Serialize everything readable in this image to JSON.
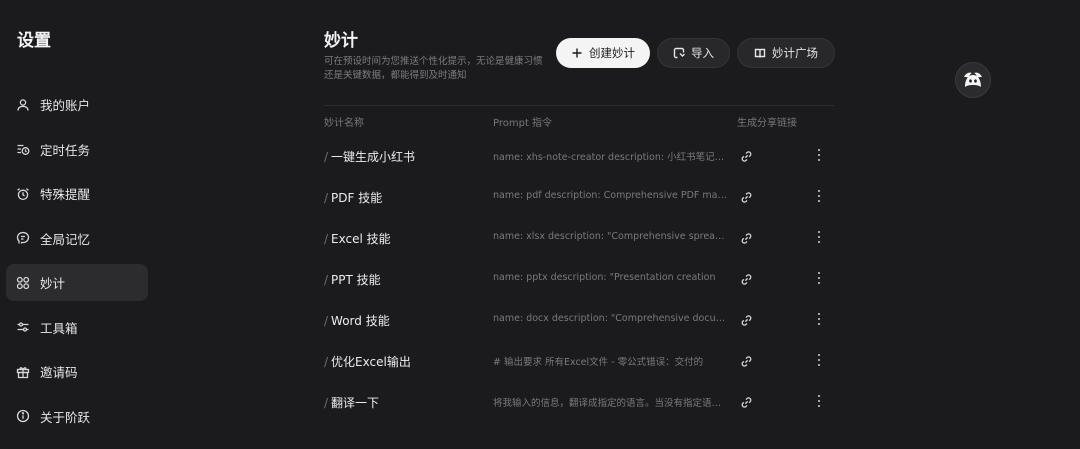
{
  "sidebar": {
    "title": "设置",
    "items": [
      {
        "label": "我的账户",
        "icon": "user-icon",
        "active": false
      },
      {
        "label": "定时任务",
        "icon": "scheduled-task-icon",
        "active": false
      },
      {
        "label": "特殊提醒",
        "icon": "alarm-clock-icon",
        "active": false
      },
      {
        "label": "全局记忆",
        "icon": "memory-icon",
        "active": false
      },
      {
        "label": "妙计",
        "icon": "grid-circles-icon",
        "active": true
      },
      {
        "label": "工具箱",
        "icon": "sliders-icon",
        "active": false
      },
      {
        "label": "邀请码",
        "icon": "gift-icon",
        "active": false
      },
      {
        "label": "关于阶跃",
        "icon": "info-icon",
        "active": false
      }
    ]
  },
  "main": {
    "title": "妙计",
    "description": "可在预设时间为您推送个性化提示，无论是健康习惯还是关键数据，都能得到及时通知",
    "buttons": {
      "create": "创建妙计",
      "import": "导入",
      "plaza": "妙计广场"
    },
    "table": {
      "headers": {
        "name": "妙计名称",
        "prompt": "Prompt 指令",
        "share": "生成分享链接"
      },
      "rows": [
        {
          "name": "一键生成小红书",
          "prompt": "name: xhs-note-creator description: 小红书笔记创作助手"
        },
        {
          "name": "PDF 技能",
          "prompt": "name: pdf description: Comprehensive PDF manipulation"
        },
        {
          "name": "Excel 技能",
          "prompt": "name: xlsx description: \"Comprehensive spreadsheet"
        },
        {
          "name": "PPT 技能",
          "prompt": "name: pptx description: \"Presentation creation"
        },
        {
          "name": "Word 技能",
          "prompt": "name: docx description: \"Comprehensive document"
        },
        {
          "name": "优化Excel输出",
          "prompt": "# 输出要求    所有Excel文件 - 零公式错误：交付的"
        },
        {
          "name": "翻译一下",
          "prompt": "将我输入的信息，翻译成指定的语言。当没有指定语言时"
        }
      ]
    }
  },
  "colors": {
    "background": "#1b1b1d",
    "active_item": "#2c2c2f",
    "primary_button": "#f4f4f4"
  }
}
